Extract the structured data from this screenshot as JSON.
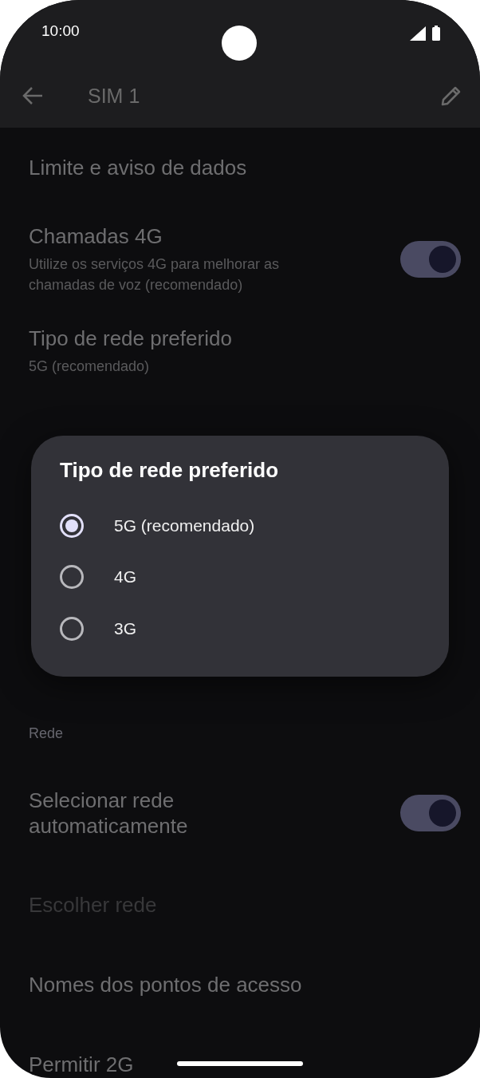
{
  "status_bar": {
    "time": "10:00"
  },
  "app_bar": {
    "title": "SIM 1"
  },
  "items": [
    {
      "kind": "setting",
      "title": "Limite e aviso de dados",
      "disabled": false
    },
    {
      "kind": "toggle",
      "title": "Chamadas 4G",
      "subtitle": "Utilize os serviços 4G para melhorar as chamadas de voz (recomendado)",
      "on": true,
      "disabled": false
    },
    {
      "kind": "setting",
      "title": "Tipo de rede preferido",
      "subtitle": "5G (recomendado)",
      "disabled": false
    },
    {
      "kind": "header",
      "title": "Rede"
    },
    {
      "kind": "toggle",
      "title": "Selecionar rede automaticamente",
      "on": true,
      "disabled": false
    },
    {
      "kind": "setting",
      "title": "Escolher rede",
      "disabled": true
    },
    {
      "kind": "setting",
      "title": "Nomes dos pontos de acesso",
      "disabled": false
    },
    {
      "kind": "setting",
      "title": "Permitir 2G",
      "disabled": false
    }
  ],
  "dialog": {
    "title": "Tipo de rede preferido",
    "options": [
      {
        "label": "5G (recomendado)",
        "selected": true
      },
      {
        "label": "4G",
        "selected": false
      },
      {
        "label": "3G",
        "selected": false
      }
    ]
  }
}
